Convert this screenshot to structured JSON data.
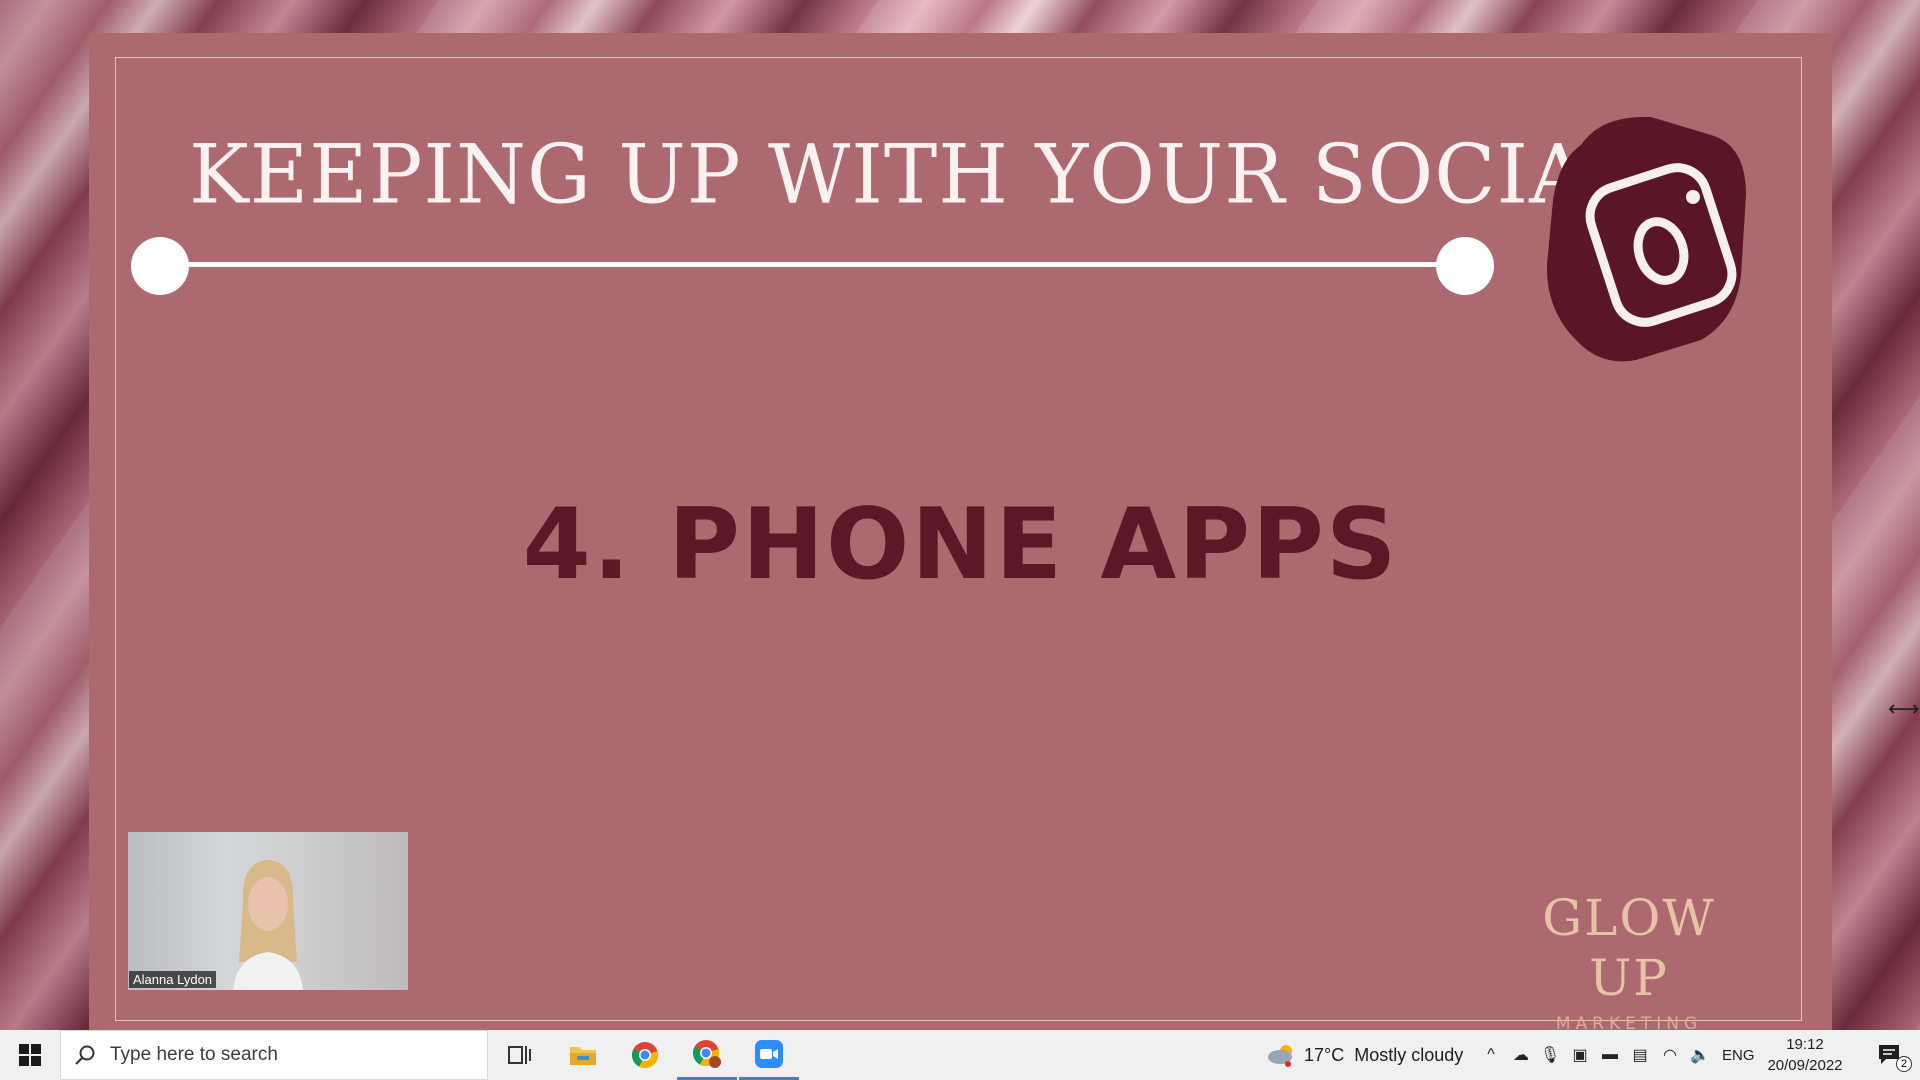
{
  "slide": {
    "title": "KEEPING UP WITH YOUR SOCIALS",
    "heading": "4. PHONE APPS",
    "brand_name": "GLOW UP",
    "brand_sub": "MARKETING",
    "icon": "instagram-icon",
    "colors": {
      "slide_bg": "#ac6a70",
      "heading": "#5c1826",
      "brand": "#e8c2a6",
      "badge": "#5a1527"
    }
  },
  "webcam": {
    "participant_name": "Alanna Lydon"
  },
  "taskbar": {
    "search_placeholder": "Type here to search",
    "weather_temp": "17°C",
    "weather_desc": "Mostly cloudy",
    "language": "ENG",
    "time": "19:12",
    "date": "20/09/2022",
    "notification_count": "2",
    "apps": [
      "task-view-icon",
      "file-explorer-icon",
      "chrome-icon",
      "chrome-profile-icon",
      "zoom-icon"
    ]
  }
}
